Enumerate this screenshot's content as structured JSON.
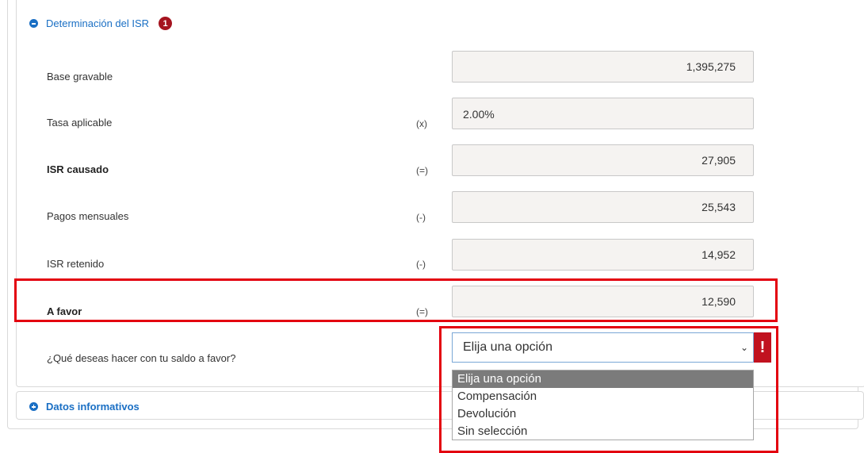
{
  "section": {
    "title": "Determinación del ISR",
    "badge": "1"
  },
  "rows": [
    {
      "label": "Base gravable",
      "operator": "",
      "value": "1,395,275"
    },
    {
      "label": "Tasa aplicable",
      "operator": "(x)",
      "value": "2.00%"
    },
    {
      "label": "ISR causado",
      "operator": "(=)",
      "value": "27,905"
    },
    {
      "label": "Pagos mensuales",
      "operator": "(-)",
      "value": "25,543"
    },
    {
      "label": "ISR retenido",
      "operator": "(-)",
      "value": "14,952"
    },
    {
      "label": "A favor",
      "operator": "(=)",
      "value": "12,590"
    }
  ],
  "saldo": {
    "question": "¿Qué deseas hacer con tu saldo a favor?",
    "selected": "Elija una opción",
    "error_mark": "!",
    "options": [
      "Elija una opción",
      "Compensación",
      "Devolución",
      "Sin selección"
    ]
  },
  "datos": {
    "title": "Datos informativos"
  },
  "colors": {
    "link_blue": "#1a6fc4",
    "highlight_red": "#e3000f",
    "badge_red": "#a5141f"
  }
}
